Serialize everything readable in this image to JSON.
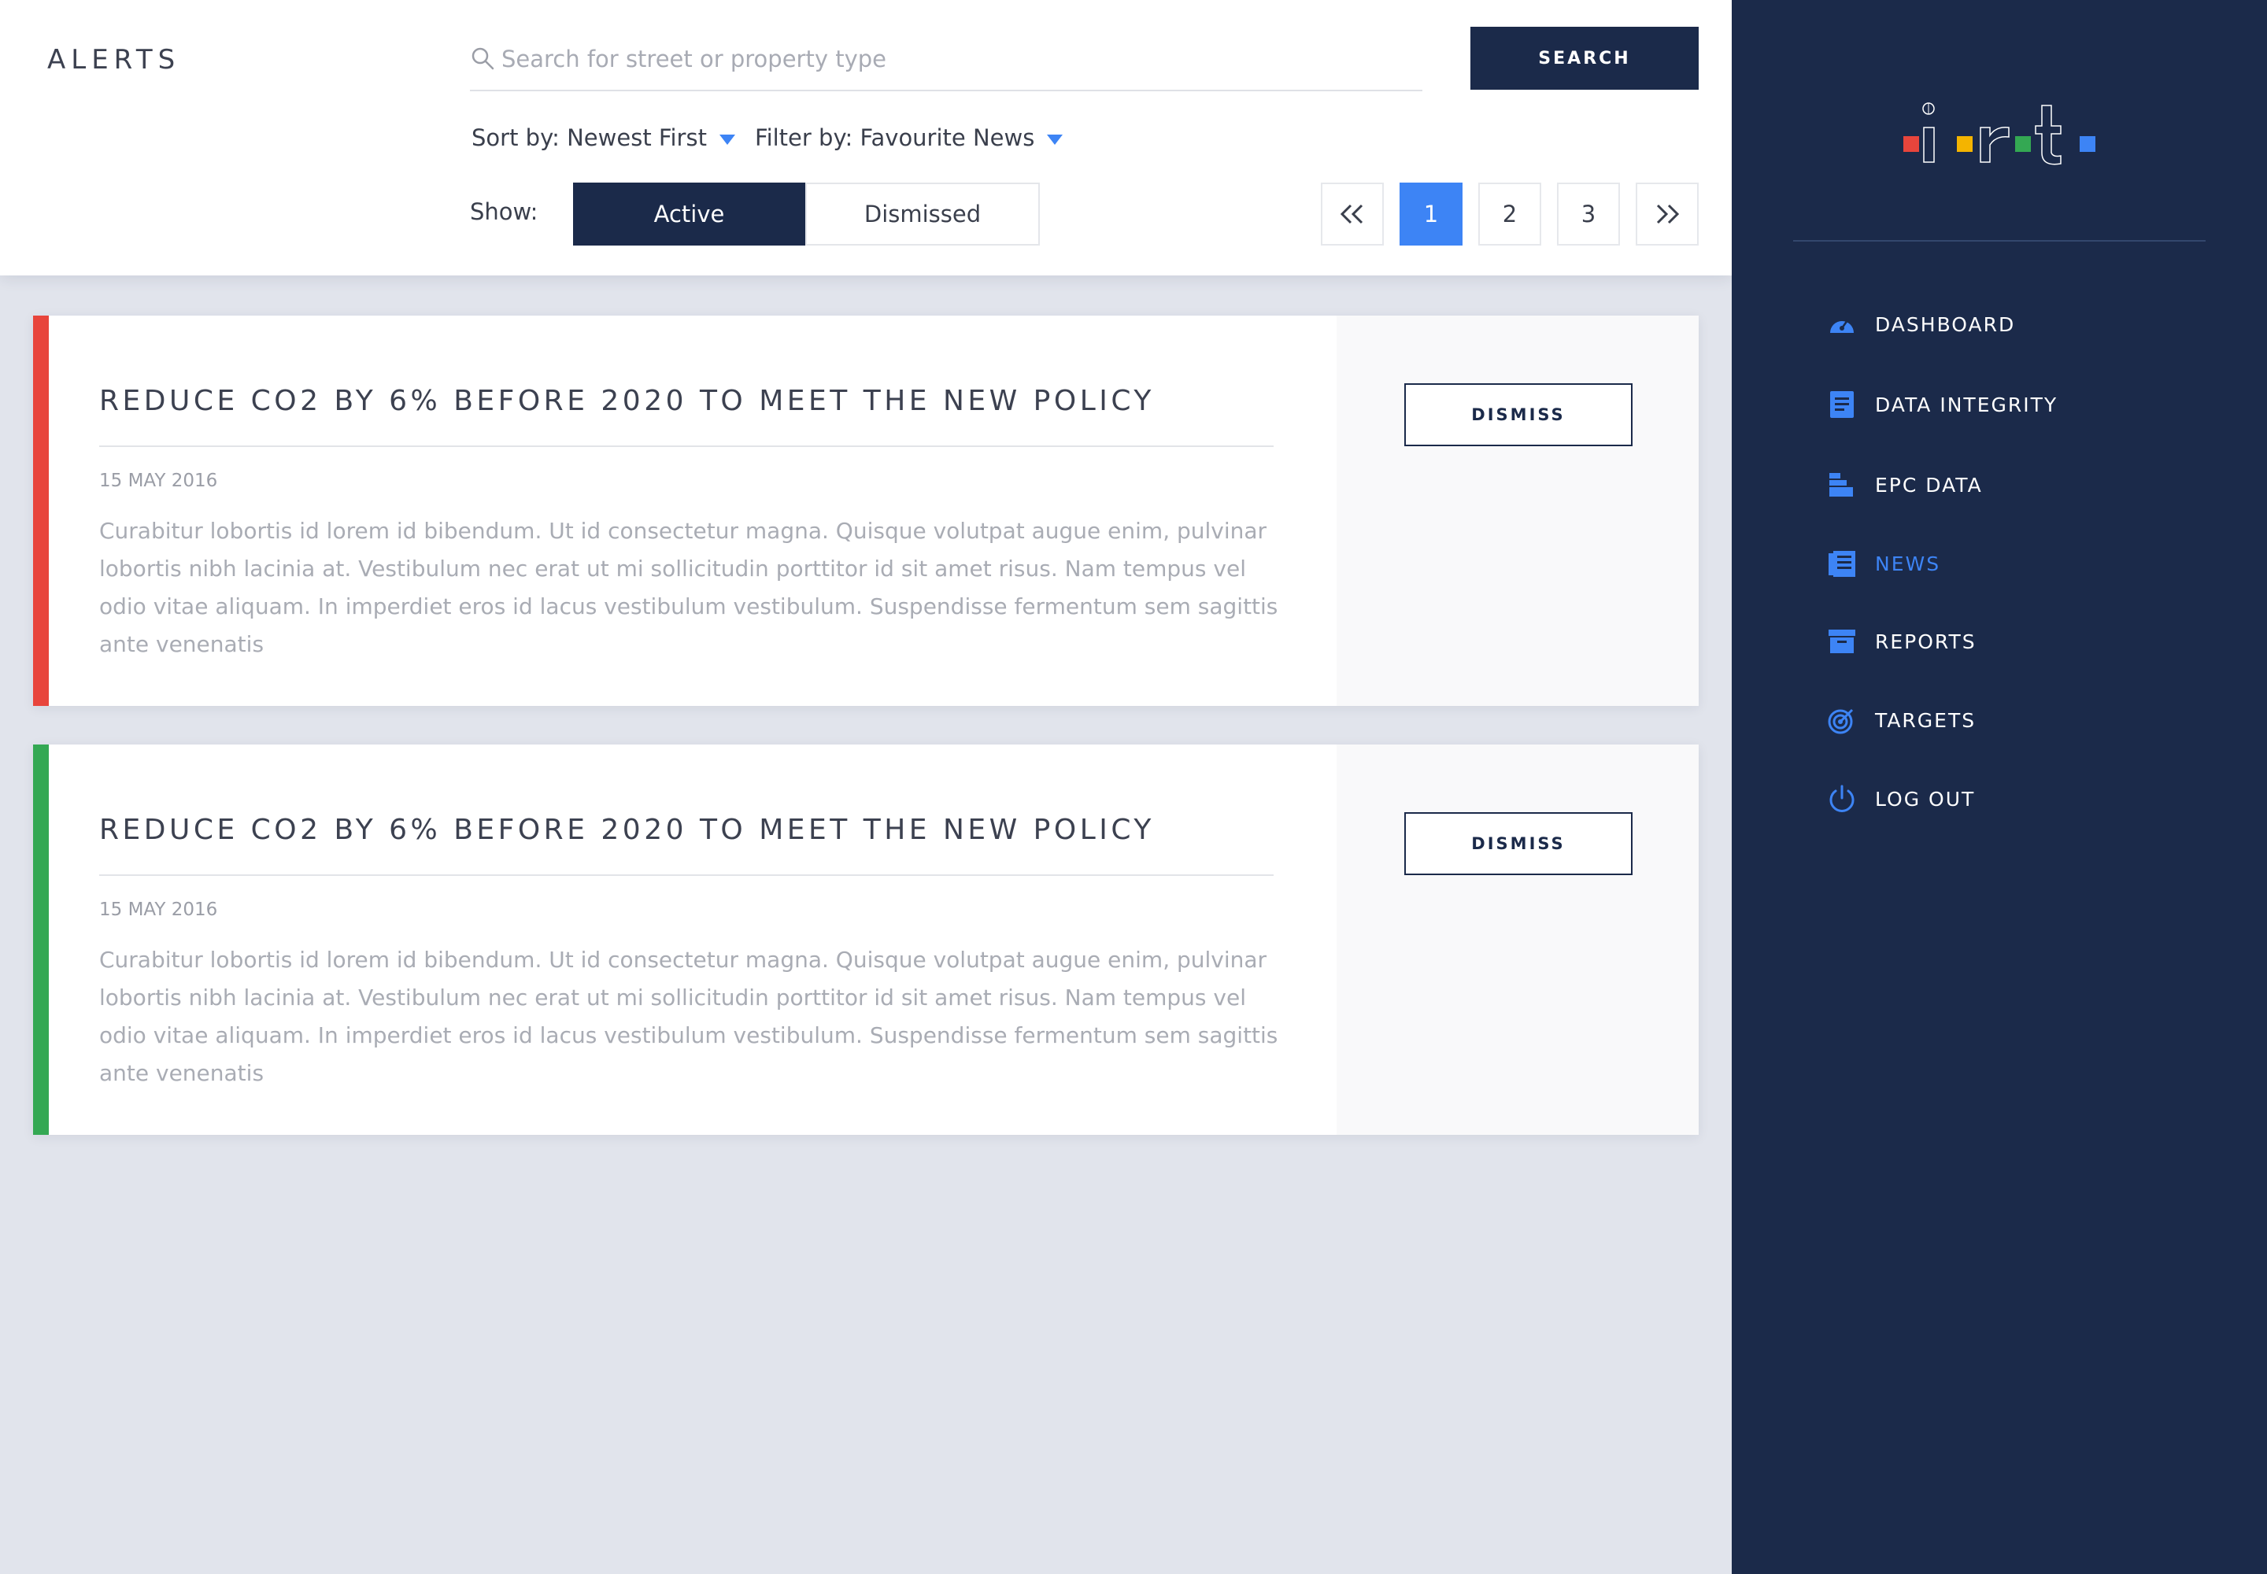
{
  "header": {
    "title": "ALERTS",
    "search": {
      "placeholder": "Search for street or property type",
      "value": "",
      "button_label": "SEARCH"
    },
    "sort": {
      "label": "Sort by: Newest First"
    },
    "filter": {
      "label": "Filter by: Favourite News"
    },
    "show": {
      "label": "Show:",
      "options": [
        "Active",
        "Dismissed"
      ],
      "selected": "Active"
    },
    "pagination": {
      "pages": [
        "1",
        "2",
        "3"
      ],
      "current": "1",
      "first_icon": "double-chevron-left-icon",
      "last_icon": "double-chevron-right-icon"
    }
  },
  "alerts": [
    {
      "title": "REDUCE CO2 BY 6% BEFORE 2020 TO MEET THE NEW POLICY",
      "date": "15 MAY 2016",
      "body": "Curabitur lobortis id lorem id bibendum. Ut id consectetur magna. Quisque volutpat augue enim, pulvinar lobortis nibh lacinia at. Vestibulum nec erat ut mi sollicitudin porttitor id sit amet risus. Nam tempus vel odio vitae aliquam. In imperdiet eros id lacus vestibulum vestibulum. Suspendisse fermentum sem sagittis ante venenatis",
      "dismiss_label": "DISMISS",
      "accent_color": "#e8453c"
    },
    {
      "title": "REDUCE CO2 BY 6% BEFORE 2020 TO MEET THE NEW POLICY",
      "date": "15 MAY 2016",
      "body": "Curabitur lobortis id lorem id bibendum. Ut id consectetur magna. Quisque volutpat augue enim, pulvinar lobortis nibh lacinia at. Vestibulum nec erat ut mi sollicitudin porttitor id sit amet risus. Nam tempus vel odio vitae aliquam. In imperdiet eros id lacus vestibulum vestibulum. Suspendisse fermentum sem sagittis ante venenatis",
      "dismiss_label": "DISMISS",
      "accent_color": "#34a853"
    }
  ],
  "sidebar": {
    "logo_text": "irt",
    "logo_colors": [
      "#e8453c",
      "#f4b400",
      "#34a853",
      "#3d84f5"
    ],
    "items": [
      {
        "label": "DASHBOARD",
        "icon": "gauge-icon",
        "active": false
      },
      {
        "label": "DATA INTEGRITY",
        "icon": "document-icon",
        "active": false
      },
      {
        "label": "EPC DATA",
        "icon": "epc-bars-icon",
        "active": false
      },
      {
        "label": "NEWS",
        "icon": "newspaper-icon",
        "active": true
      },
      {
        "label": "REPORTS",
        "icon": "archive-box-icon",
        "active": false
      },
      {
        "label": "TARGETS",
        "icon": "target-icon",
        "active": false
      },
      {
        "label": "LOG OUT",
        "icon": "power-icon",
        "active": false
      }
    ]
  },
  "colors": {
    "navy": "#1b2a4a",
    "accent_blue": "#3d84f5",
    "background": "#e1e4ec"
  }
}
